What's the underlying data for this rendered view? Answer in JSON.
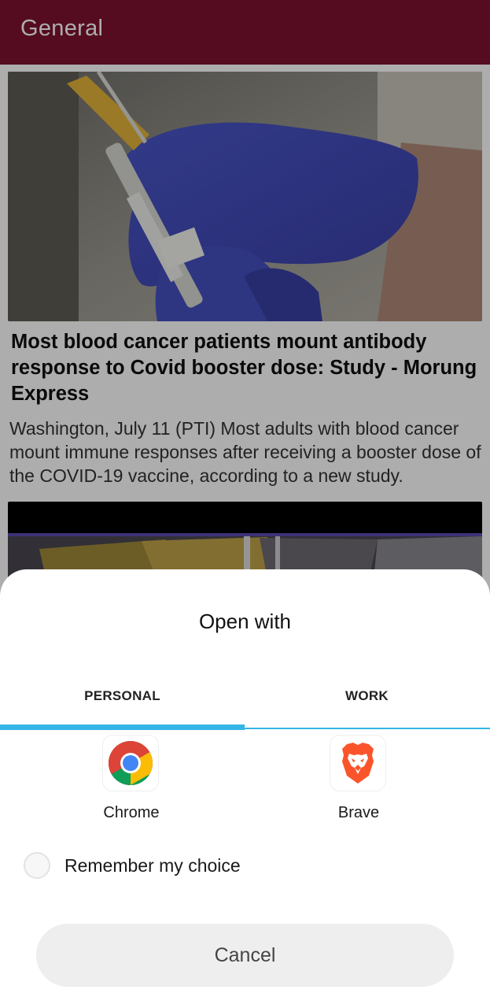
{
  "app_bar": {
    "title": "General",
    "color": "#7e1230"
  },
  "feed": {
    "articles": [
      {
        "title": "Most blood cancer patients mount antibody response to Covid booster dose: Study - Morung Express",
        "description": "Washington, July 11 (PTI) Most adults with blood cancer mount immune responses after receiving a booster dose of the COVID-19 vaccine, according to a new study.",
        "image": "syringe-gloved-hands-photo"
      },
      {
        "image": "telescope-mirror-photo"
      }
    ]
  },
  "open_with_sheet": {
    "title": "Open with",
    "tabs": [
      {
        "label": "PERSONAL",
        "selected": true
      },
      {
        "label": "WORK",
        "selected": false
      }
    ],
    "accent_color": "#33b5e5",
    "apps": [
      {
        "label": "Chrome",
        "icon": "chrome-icon"
      },
      {
        "label": "Brave",
        "icon": "brave-icon"
      }
    ],
    "remember_choice": {
      "label": "Remember my choice",
      "checked": false
    },
    "cancel_label": "Cancel"
  }
}
